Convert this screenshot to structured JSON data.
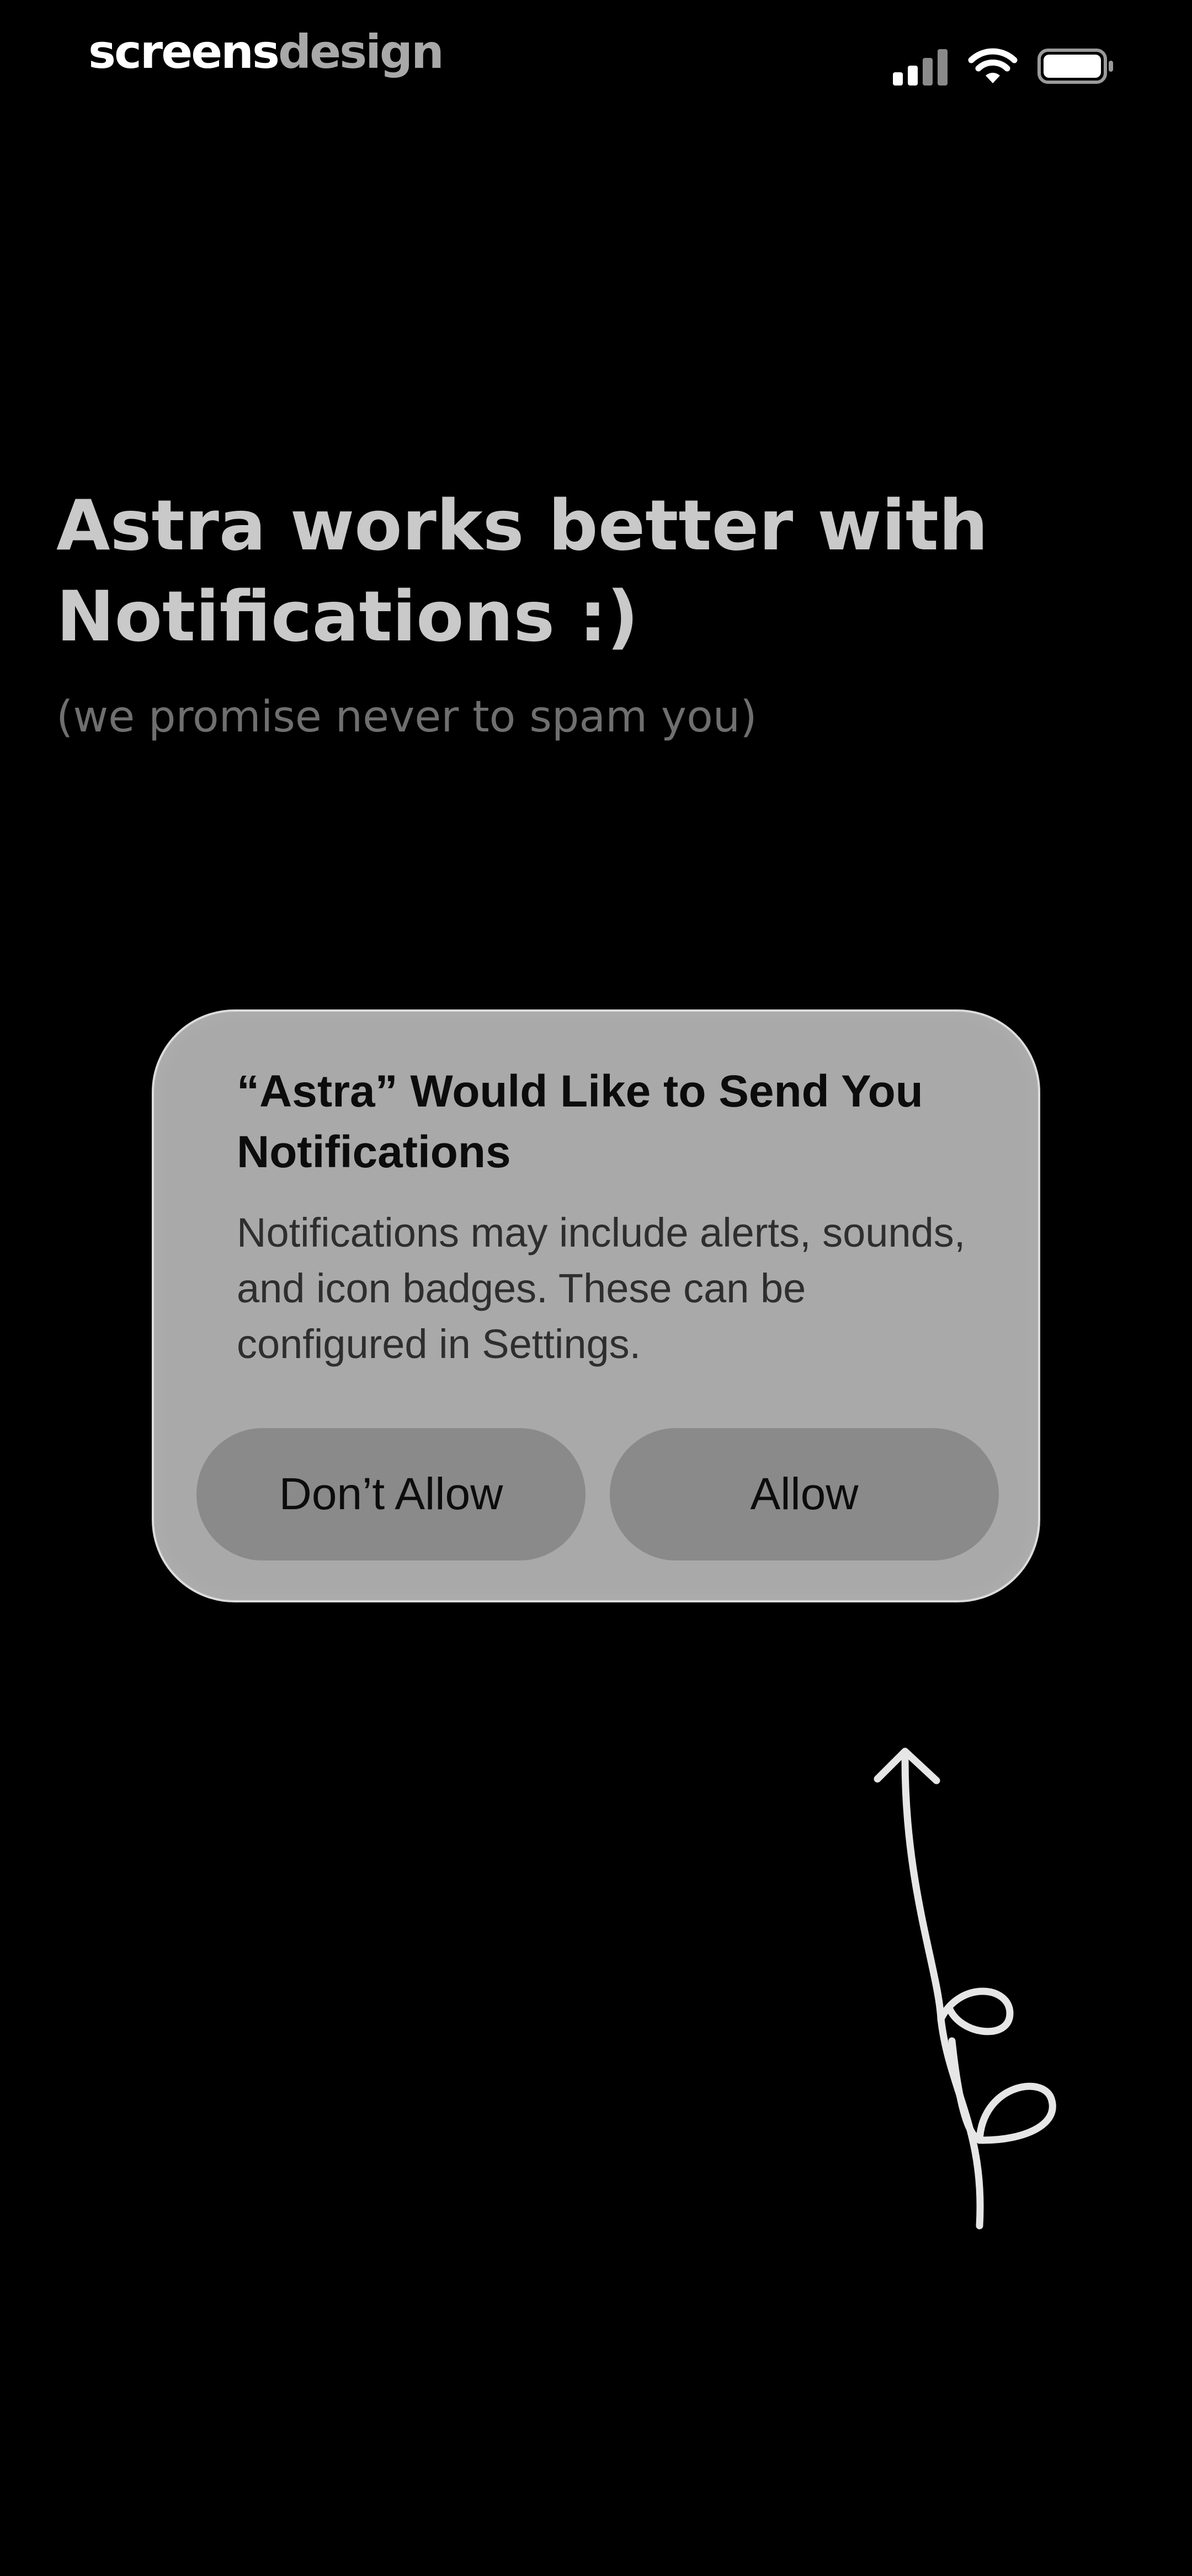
{
  "status_bar": {
    "brand_part1": "screens",
    "brand_part2": "design",
    "icons": [
      "cellular-signal-icon",
      "wifi-icon",
      "battery-icon"
    ]
  },
  "main": {
    "title": "Astra works better with Notifications :)",
    "subtitle": "(we promise never to spam you)"
  },
  "alert": {
    "title": "“Astra” Would Like to Send You Notifications",
    "message": "Notifications may include alerts, sounds, and icon badges. These can be configured in Settings.",
    "deny_label": "Don’t Allow",
    "allow_label": "Allow"
  },
  "colors": {
    "background": "#000000",
    "title": "#c9c9c9",
    "subtitle": "#6f6f6f",
    "alert_background": "#a9a9a9",
    "alert_button": "#8a8a8a"
  }
}
